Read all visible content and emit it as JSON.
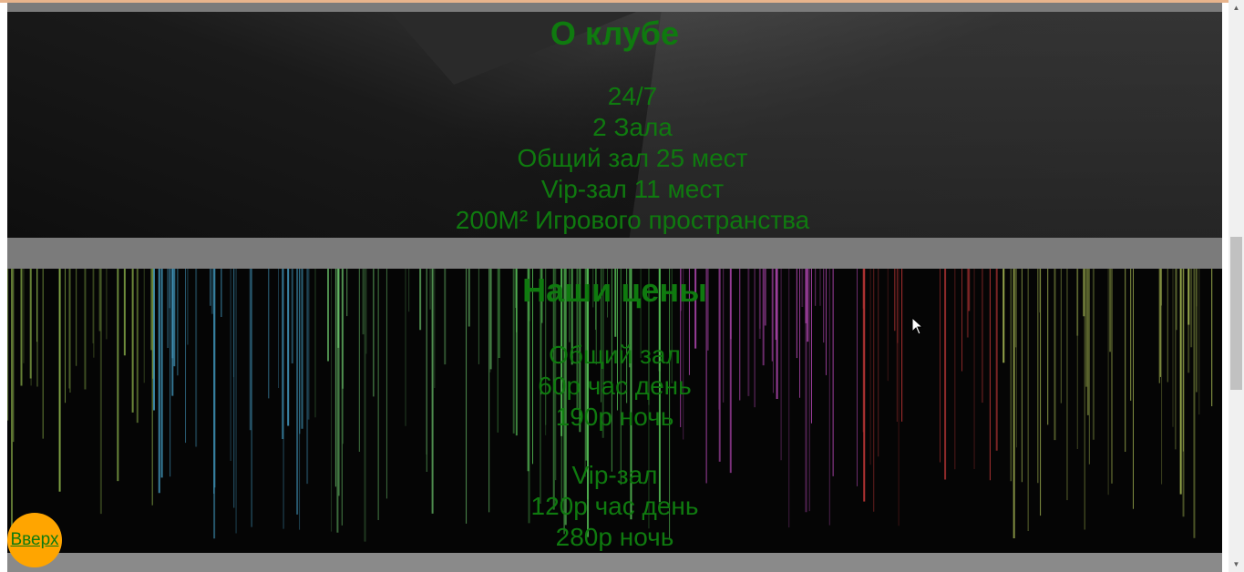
{
  "club": {
    "title": "О клубе",
    "items": [
      "24/7",
      "2 Зала",
      "Общий зал 25 мест",
      "Vip-зал 11 мест",
      "200M² Игрового пространства"
    ]
  },
  "prices": {
    "title": "Наши цены",
    "general": {
      "name": "Общий зал",
      "day": "60р час день",
      "night": "190р ночь"
    },
    "vip": {
      "name": "Vip-зал",
      "day": "120р час день",
      "night": "280р ночь"
    }
  },
  "to_top_label": "Вверх",
  "colors": {
    "text": "#0f7a0f",
    "to_top_bg": "#ffa500",
    "section_gap": "#7b7b7b"
  },
  "icons": {
    "scroll_up": "arrow-up-icon",
    "scroll_down": "arrow-down-icon",
    "cursor": "mouse-cursor-icon"
  }
}
